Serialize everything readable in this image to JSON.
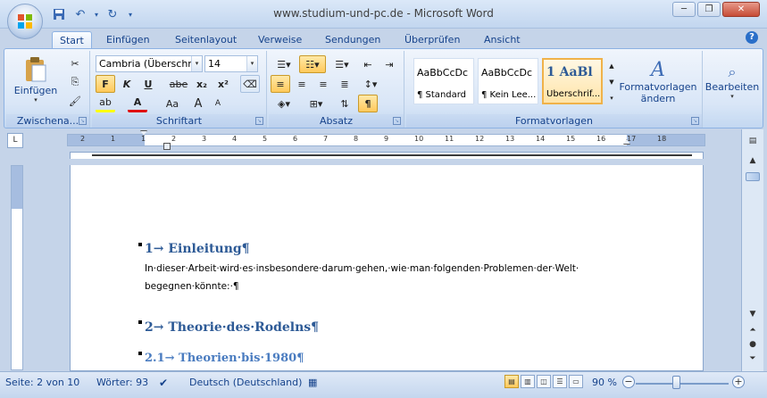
{
  "window": {
    "title": "www.studium-und-pc.de - Microsoft Word"
  },
  "qat": {
    "save_icon": "save-icon",
    "undo_icon": "undo-icon",
    "redo_icon": "redo-icon",
    "more": "▾"
  },
  "tabs": [
    "Start",
    "Einfügen",
    "Seitenlayout",
    "Verweise",
    "Sendungen",
    "Überprüfen",
    "Ansicht"
  ],
  "ribbon": {
    "clipboard": {
      "label": "Zwischena...",
      "paste": "Einfügen"
    },
    "font": {
      "label": "Schriftart",
      "family": "Cambria (Überschrif",
      "size": "14",
      "bold": "F",
      "italic": "K",
      "underline": "U",
      "strike": "abe",
      "sub": "x₂",
      "sup": "x²",
      "highlight": "ab",
      "fontcolor": "A",
      "case": "Aa",
      "grow": "A",
      "shrink": "A"
    },
    "paragraph": {
      "label": "Absatz",
      "pilcrow": "¶"
    },
    "styles": {
      "label": "Formatvorlagen",
      "items": [
        {
          "preview": "AaBbCcDc",
          "name": "¶ Standard"
        },
        {
          "preview": "AaBbCcDc",
          "name": "¶ Kein Lee..."
        },
        {
          "preview": "1  AaBl",
          "name": "Überschrif..."
        }
      ],
      "change": "Formatvorlagen",
      "change2": "ändern"
    },
    "editing": {
      "label": "Bearbeiten"
    }
  },
  "document": {
    "h1a": "1→ Einleitung¶",
    "p1a": "In·dieser·Arbeit·wird·es·insbesondere·darum·gehen,·wie·man·folgenden·Problemen·der·Welt·",
    "p1b": "begegnen·könnte:·¶",
    "h1b": "2→ Theorie·des·Rodelns¶",
    "h2a": "2.1→ Theorien·bis·1980¶"
  },
  "status": {
    "page": "Seite: 2 von 10",
    "words": "Wörter: 93",
    "language": "Deutsch (Deutschland)",
    "zoom": "90 %"
  },
  "ruler_labels": [
    "2",
    "1",
    "1",
    "2",
    "3",
    "4",
    "5",
    "6",
    "7",
    "8",
    "9",
    "10",
    "11",
    "12",
    "13",
    "14",
    "15",
    "16",
    "17",
    "18"
  ],
  "colors": {
    "accent": "#15428b",
    "heading": "#2d5a96",
    "subheading": "#4a7cc0"
  }
}
